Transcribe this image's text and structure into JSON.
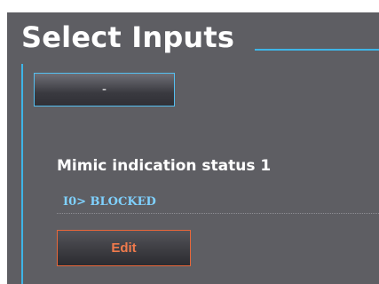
{
  "panel": {
    "title": "Select Inputs",
    "select_button_label": "-"
  },
  "status": {
    "label": "Mimic indication status 1",
    "value": "I0> BLOCKED"
  },
  "actions": {
    "edit_label": "Edit"
  },
  "colors": {
    "panel_bg": "#5e5e63",
    "accent": "#3eb4e6",
    "value_text": "#7fd1ff",
    "edit_border": "#e8673a",
    "edit_text": "#f07a4c"
  }
}
